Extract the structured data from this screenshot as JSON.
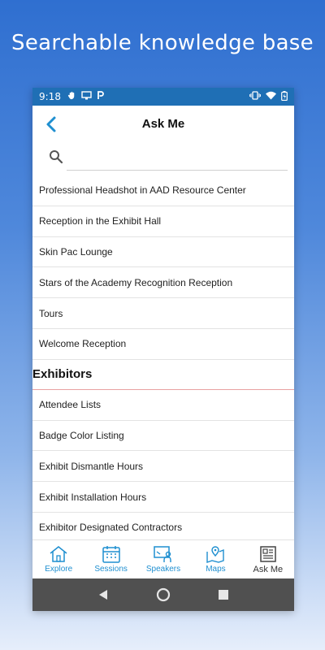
{
  "headline": "Searchable knowledge base",
  "status_bar": {
    "time": "9:18",
    "left_icons": [
      "hand-icon",
      "cast-icon",
      "parking-icon"
    ],
    "right_icons": [
      "vibrate-icon",
      "wifi-icon",
      "battery-icon"
    ]
  },
  "header": {
    "title": "Ask Me",
    "back_icon": "chevron-left-icon"
  },
  "search": {
    "icon": "search-icon",
    "value": "",
    "placeholder": ""
  },
  "list": {
    "items_top": [
      "Professional Headshot in AAD Resource Center",
      "Reception in the Exhibit Hall",
      "Skin Pac Lounge",
      "Stars of the Academy Recognition Reception",
      "Tours",
      "Welcome Reception"
    ],
    "section_header": "Exhibitors",
    "items_bottom": [
      "Attendee Lists",
      "Badge Color Listing",
      "Exhibit Dismantle Hours",
      "Exhibit Installation Hours",
      "Exhibitor Designated Contractors"
    ]
  },
  "tabs": [
    {
      "label": "Explore",
      "icon": "home-icon"
    },
    {
      "label": "Sessions",
      "icon": "calendar-icon"
    },
    {
      "label": "Speakers",
      "icon": "speaker-icon"
    },
    {
      "label": "Maps",
      "icon": "map-icon"
    },
    {
      "label": "Ask Me",
      "icon": "document-icon"
    }
  ],
  "colors": {
    "accent": "#1f8fd0",
    "status_bar": "#1f6fb5",
    "section_divider": "#e8a1a1",
    "nav_bar": "#505050"
  }
}
